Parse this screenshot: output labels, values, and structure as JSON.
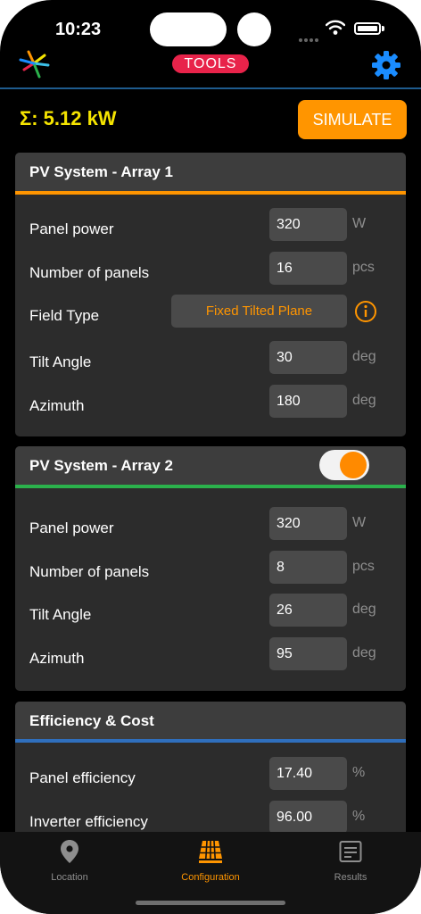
{
  "status": {
    "time": "10:23"
  },
  "header": {
    "tools_label": "TOOLS"
  },
  "summary": {
    "total_power": "Σ: 5.12 kW",
    "simulate_label": "SIMULATE"
  },
  "array1": {
    "title": "PV System - Array 1",
    "rows": [
      {
        "label": "Panel power",
        "value": "320",
        "unit": "W"
      },
      {
        "label": "Number of panels",
        "value": "16",
        "unit": "pcs"
      },
      {
        "label": "Field Type",
        "value": "Fixed Tilted Plane"
      },
      {
        "label": "Tilt Angle",
        "value": "30",
        "unit": "deg"
      },
      {
        "label": "Azimuth",
        "value": "180",
        "unit": "deg"
      }
    ]
  },
  "array2": {
    "title": "PV System - Array 2",
    "enabled": true,
    "rows": [
      {
        "label": "Panel power",
        "value": "320",
        "unit": "W"
      },
      {
        "label": "Number of panels",
        "value": "8",
        "unit": "pcs"
      },
      {
        "label": "Tilt Angle",
        "value": "26",
        "unit": "deg"
      },
      {
        "label": "Azimuth",
        "value": "95",
        "unit": "deg"
      }
    ]
  },
  "efficiency": {
    "title": "Efficiency & Cost",
    "rows": [
      {
        "label": "Panel efficiency",
        "value": "17.40",
        "unit": "%"
      },
      {
        "label": "Inverter efficiency",
        "value": "96.00",
        "unit": "%"
      }
    ]
  },
  "tabs": [
    {
      "label": "Location",
      "icon": "location-pin-icon",
      "active": false
    },
    {
      "label": "Configuration",
      "icon": "solar-panel-icon",
      "active": true
    },
    {
      "label": "Results",
      "icon": "results-list-icon",
      "active": false
    }
  ],
  "colors": {
    "accent_orange": "#ff9500",
    "tools_badge": "#e8234a",
    "array1_bar": "#ff9500",
    "array2_bar": "#2bb24c",
    "efficiency_bar": "#2f6fbd",
    "sum_text": "#f5e400",
    "gear": "#1a8cff"
  }
}
